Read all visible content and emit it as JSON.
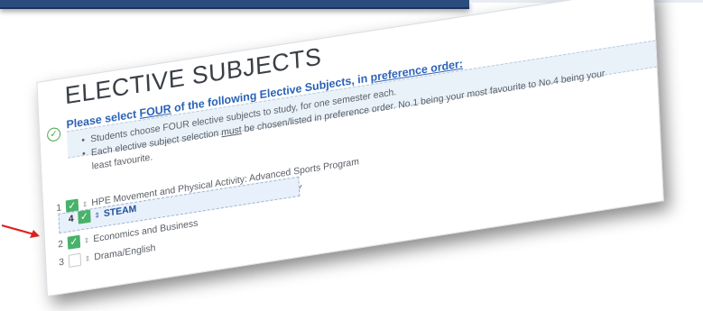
{
  "section": {
    "title": "ELECTIVE SUBJECTS",
    "instruction_prefix": "Please select ",
    "instruction_count": "FOUR",
    "instruction_mid": " of the following Elective Subjects, in ",
    "instruction_order": "preference order:",
    "bullet1": "Students choose FOUR elective subjects to study, for one semester each.",
    "bullet2_a": "Each elective subject selection ",
    "bullet2_must": "must",
    "bullet2_b": " be chosen/listed in preference order.  No.1 being your most favourite to No.4 being your",
    "bullet2_cont": "least favourite."
  },
  "subjects": [
    {
      "num": "1",
      "label": "HPE Movement and Physical Activity: Advanced Sports Program",
      "checked": true
    },
    {
      "num": "4",
      "label": "STEAM",
      "checked": true,
      "dragging": true
    },
    {
      "num": "",
      "label": "Design and Technologies: Food and Fibre - DAIRY",
      "checked": true
    },
    {
      "num": "2",
      "label": "Economics and Business",
      "checked": true
    },
    {
      "num": "3",
      "label": "Drama/English",
      "checked": false
    }
  ],
  "colors": {
    "accent_blue": "#2a62b8",
    "check_green": "#49b26a",
    "arrow_red": "#e02020"
  }
}
